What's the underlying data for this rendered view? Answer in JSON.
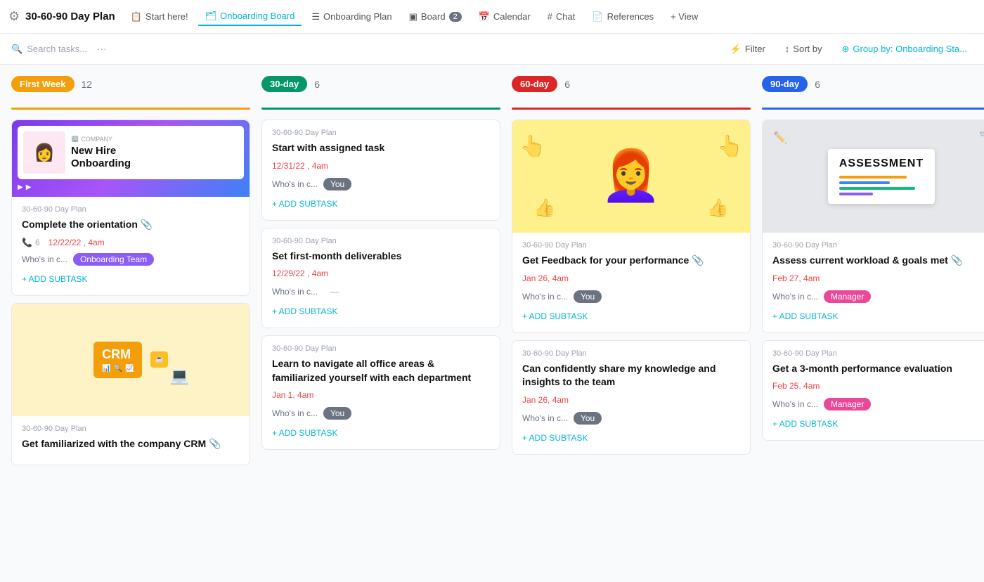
{
  "header": {
    "title": "30-60-90 Day Plan",
    "logo_icon": "⚙",
    "nav": [
      {
        "id": "start-here",
        "label": "Start here!",
        "icon": "📋",
        "active": false
      },
      {
        "id": "onboarding-board",
        "label": "Onboarding Board",
        "icon": "🗂",
        "active": true
      },
      {
        "id": "onboarding-plan",
        "label": "Onboarding Plan",
        "icon": "☰",
        "active": false
      },
      {
        "id": "board",
        "label": "Board",
        "icon": "▣",
        "active": false,
        "badge": "2"
      },
      {
        "id": "calendar",
        "label": "Calendar",
        "icon": "📅",
        "active": false
      },
      {
        "id": "chat",
        "label": "Chat",
        "icon": "#",
        "active": false
      },
      {
        "id": "references",
        "label": "References",
        "icon": "📄",
        "active": false
      },
      {
        "id": "add-view",
        "label": "+ View",
        "active": false
      }
    ]
  },
  "toolbar": {
    "search_placeholder": "Search tasks...",
    "filter_label": "Filter",
    "sort_label": "Sort by",
    "group_by_label": "Group by: Onboarding Sta..."
  },
  "columns": [
    {
      "id": "first-week",
      "tag": "First Week",
      "tag_class": "tag-first-week",
      "line_class": "line-yellow",
      "count": 12
    },
    {
      "id": "30-day",
      "tag": "30-day",
      "tag_class": "tag-30day",
      "line_class": "line-green",
      "count": 6
    },
    {
      "id": "60-day",
      "tag": "60-day",
      "tag_class": "tag-60day",
      "line_class": "line-red",
      "count": 6
    },
    {
      "id": "90-day",
      "tag": "90-day",
      "tag_class": "tag-90day",
      "line_class": "line-blue",
      "count": 6
    }
  ],
  "cards": {
    "first_week": [
      {
        "id": "fw1",
        "type": "onboarding-image",
        "plan": "30-60-90 Day Plan",
        "title": "Complete the orientation",
        "has_attachment": true,
        "subtask_count": "6",
        "date": "12/22/22 , 4am",
        "who_label": "Who's in c...",
        "assignee": "Onboarding Team",
        "assignee_class": "assignee-onboarding",
        "add_subtask": "+ ADD SUBTASK"
      },
      {
        "id": "fw2",
        "type": "crm-image",
        "plan": "30-60-90 Day Plan",
        "title": "Get familiarized with the company CRM",
        "has_attachment": true
      }
    ],
    "thirty_day": [
      {
        "id": "td1",
        "type": "plain",
        "plan": "30-60-90 Day Plan",
        "title": "Start with assigned task",
        "date": "12/31/22 , 4am",
        "who_label": "Who's in c...",
        "assignee": "You",
        "assignee_class": "assignee-you",
        "add_subtask": "+ ADD SUBTASK"
      },
      {
        "id": "td2",
        "type": "plain",
        "plan": "30-60-90 Day Plan",
        "title": "Set first-month deliverables",
        "date": "12/29/22 , 4am",
        "who_label": "Who's in c...",
        "assignee": "—",
        "assignee_class": "assignee-dash",
        "add_subtask": "+ ADD SUBTASK"
      },
      {
        "id": "td3",
        "type": "plain",
        "plan": "30-60-90 Day Plan",
        "title": "Learn to navigate all office areas & familiarized yourself with each department",
        "date": "Jan 1, 4am",
        "who_label": "Who's in c...",
        "assignee": "You",
        "assignee_class": "assignee-you",
        "add_subtask": "+ ADD SUBTASK"
      }
    ],
    "sixty_day": [
      {
        "id": "sd1",
        "type": "yellow-person",
        "plan": "30-60-90 Day Plan",
        "title": "Get Feedback for your performance",
        "has_attachment": true,
        "date": "Jan 26, 4am",
        "who_label": "Who's in c...",
        "assignee": "You",
        "assignee_class": "assignee-you",
        "add_subtask": "+ ADD SUBTASK"
      },
      {
        "id": "sd2",
        "type": "plain",
        "plan": "30-60-90 Day Plan",
        "title": "Can confidently share my knowledge and insights to the team",
        "date": "Jan 26, 4am",
        "who_label": "Who's in c...",
        "assignee": "You",
        "assignee_class": "assignee-you",
        "add_subtask": "+ ADD SUBTASK"
      }
    ],
    "ninety_day": [
      {
        "id": "nd1",
        "type": "assessment-image",
        "plan": "30-60-90 Day Plan",
        "title": "Assess current workload & goals met",
        "has_attachment": true,
        "date": "Feb 27, 4am",
        "who_label": "Who's in c...",
        "assignee": "Manager",
        "assignee_class": "assignee-manager",
        "add_subtask": "+ ADD SUBTASK"
      },
      {
        "id": "nd2",
        "type": "plain",
        "plan": "30-60-90 Day Plan",
        "title": "Get a 3-month performance evaluation",
        "date": "Feb 25, 4am",
        "who_label": "Who's in c...",
        "assignee": "Manager",
        "assignee_class": "assignee-manager",
        "add_subtask": "+ ADD SUBTASK"
      }
    ]
  }
}
